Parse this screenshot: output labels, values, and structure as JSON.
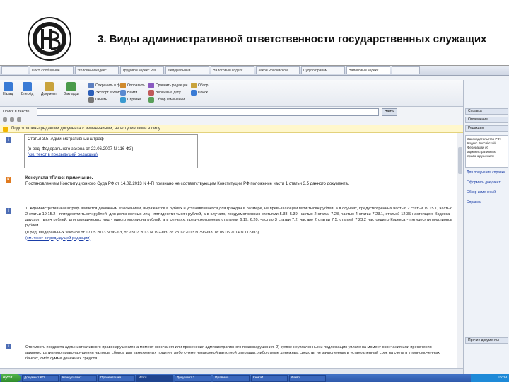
{
  "slide": {
    "title": "3. Виды административной ответственности государственных служащих"
  },
  "browser_tabs": [
    "",
    "Пост. сообщение...",
    "Уголовный кодекс...",
    "Трудовой кодекс РФ",
    "Федеральный ...",
    "Налоговый кодекс...",
    "Закон Российской...",
    "Суд по правам...",
    "Налоговый кодекс ...",
    ""
  ],
  "toolbar": {
    "big_buttons": [
      "Назад",
      "Вперёд",
      "Документ",
      "Закладки"
    ],
    "small_buttons": [
      "Сохранить в файл",
      "Экспорт в Word",
      "Печать",
      "Отправить",
      "Найти",
      "Справка"
    ],
    "mid_buttons": [
      "Сравнить редакции",
      "Версия на дату",
      "Обзор изменений"
    ],
    "right_buttons": [
      "Обзор",
      "Поиск"
    ]
  },
  "search": {
    "label": "Поиск в тексте",
    "value": "",
    "go_label": "Найти"
  },
  "warning_text": "Подготовлены редакции документа с изменениями, не вступившими в силу",
  "doc": {
    "box_title": "Статья 3.5. Административный штраф",
    "box_line2": "(в ред. Федерального закона от 22.06.2007 N 116-ФЗ)",
    "box_line3": "(см. текст в предыдущей редакции)",
    "consult_head": "КонсультантПлюс: примечание.",
    "consult_line": "Постановлением Конституционного Суда РФ от 14.02.2013 N 4-П признано не соответствующим Конституции РФ положение части 1 статьи 3.5 данного документа.",
    "para_intro": "1. Административный штраф является денежным взысканием, выражается в рублях и устанавливается для граждан в размере, не превышающем пяти тысяч рублей, а в случаях, предусмотренных частью 2 статьи 19.15.1, частью 2 статьи 19.15.2 - пятидесяти тысяч рублей; для должностных лиц - пятидесяти тысяч рублей, а в случаях, предусмотренных статьями 5.38, 5.39, частью 2 статьи 7.23, частью 4 статьи 7.23.1, статьей 12.35 настоящего Кодекса - двухсот тысяч рублей; для юридических лиц - одного миллиона рублей, а в случаях, предусмотренных статьями 6.19, 6.20, частью 3 статьи 7.2, частью 2 статьи 7.5, статьей 7.23.2 настоящего Кодекса - пятидесяти миллионов рублей.",
    "para_tail": "(в ред. Федеральных законов от 07.05.2013 N 96-ФЗ, от 23.07.2013 N 192-ФЗ, от 28.12.2013 N 396-ФЗ, от 05.05.2014 N 112-ФЗ)",
    "para_see": "(см. текст в предыдущей редакции)",
    "para2": "Стоимость предмета административного правонарушения на момент окончания или пресечения административного правонарушения. 2) сумме неуплаченных и подлежащих уплате на момент окончания или пресечения административного правонарушения налогов, сборов или таможенных пошлин, либо сумме незаконной валютной операции, либо сумме денежных средств, не зачисленных в установленный срок на счета в уполномоченных банках, либо сумме денежных средств"
  },
  "right_panel": {
    "items": [
      "Справка",
      "Оглавление",
      "Редакции"
    ],
    "box_text": "Законодательство РФ: Кодекс Российской Федерации об административных правонарушениях",
    "links": [
      "Для получения справки",
      "Оформить документ",
      "Обзор изменений",
      "Справка"
    ],
    "heads": [
      "Прочие документы"
    ]
  },
  "taskbar": {
    "start": "пуск",
    "items": [
      "Документ КП",
      "Консультант",
      "Презентация",
      "Word",
      "Документ 2",
      "Правила",
      "Книга1",
      "Файл"
    ],
    "tray": "15:39"
  }
}
